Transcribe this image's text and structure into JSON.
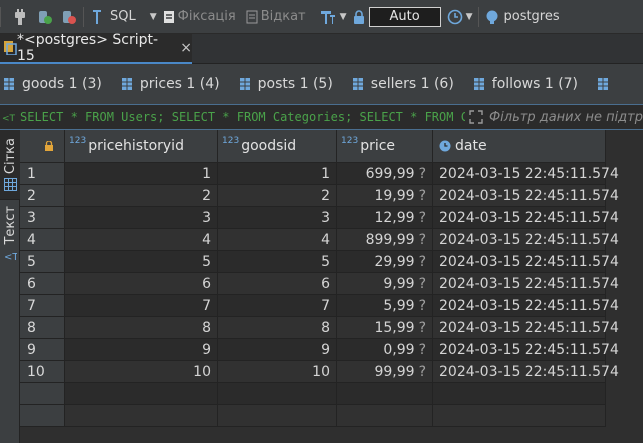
{
  "toolbar": {
    "sql_label": "SQL",
    "commit_label": "Фіксація",
    "rollback_label": "Відкат",
    "tx_mode": "Auto",
    "connection_label": "postgres"
  },
  "editor_tab": {
    "label": "*<postgres> Script-15",
    "close_glyph": "×"
  },
  "result_tabs": [
    {
      "label": "goods 1 (3)"
    },
    {
      "label": "prices 1 (4)"
    },
    {
      "label": "posts 1 (5)"
    },
    {
      "label": "sellers 1 (6)"
    },
    {
      "label": "follows 1 (7)"
    }
  ],
  "filter": {
    "sql": "SELECT * FROM Users; SELECT * FROM Categories; SELECT * FROM C",
    "placeholder": "Фільтр даних не підтр"
  },
  "side_tabs": {
    "grid_label": "Сітка",
    "text_label": "Текст"
  },
  "grid": {
    "type_badge": "123",
    "columns": [
      {
        "label": "pricehistoryid"
      },
      {
        "label": "goodsid"
      },
      {
        "label": "price"
      },
      {
        "label": "date"
      }
    ],
    "rows": [
      {
        "idx": "1",
        "pricehistoryid": "1",
        "goodsid": "1",
        "price": "699,99",
        "date": "2024-03-15 22:45:11.574"
      },
      {
        "idx": "2",
        "pricehistoryid": "2",
        "goodsid": "2",
        "price": "19,99",
        "date": "2024-03-15 22:45:11.574"
      },
      {
        "idx": "3",
        "pricehistoryid": "3",
        "goodsid": "3",
        "price": "12,99",
        "date": "2024-03-15 22:45:11.574"
      },
      {
        "idx": "4",
        "pricehistoryid": "4",
        "goodsid": "4",
        "price": "899,99",
        "date": "2024-03-15 22:45:11.574"
      },
      {
        "idx": "5",
        "pricehistoryid": "5",
        "goodsid": "5",
        "price": "29,99",
        "date": "2024-03-15 22:45:11.574"
      },
      {
        "idx": "6",
        "pricehistoryid": "6",
        "goodsid": "6",
        "price": "9,99",
        "date": "2024-03-15 22:45:11.574"
      },
      {
        "idx": "7",
        "pricehistoryid": "7",
        "goodsid": "7",
        "price": "5,99",
        "date": "2024-03-15 22:45:11.574"
      },
      {
        "idx": "8",
        "pricehistoryid": "8",
        "goodsid": "8",
        "price": "15,99",
        "date": "2024-03-15 22:45:11.574"
      },
      {
        "idx": "9",
        "pricehistoryid": "9",
        "goodsid": "9",
        "price": "0,99",
        "date": "2024-03-15 22:45:11.574"
      },
      {
        "idx": "10",
        "pricehistoryid": "10",
        "goodsid": "10",
        "price": "99,99",
        "date": "2024-03-15 22:45:11.574"
      }
    ],
    "price_suffix": "?"
  },
  "colors": {
    "accent": "#4a88c7",
    "sql_green": "#4aa24a",
    "red_icon": "#d9534f",
    "orange_icon": "#e2a53a"
  }
}
